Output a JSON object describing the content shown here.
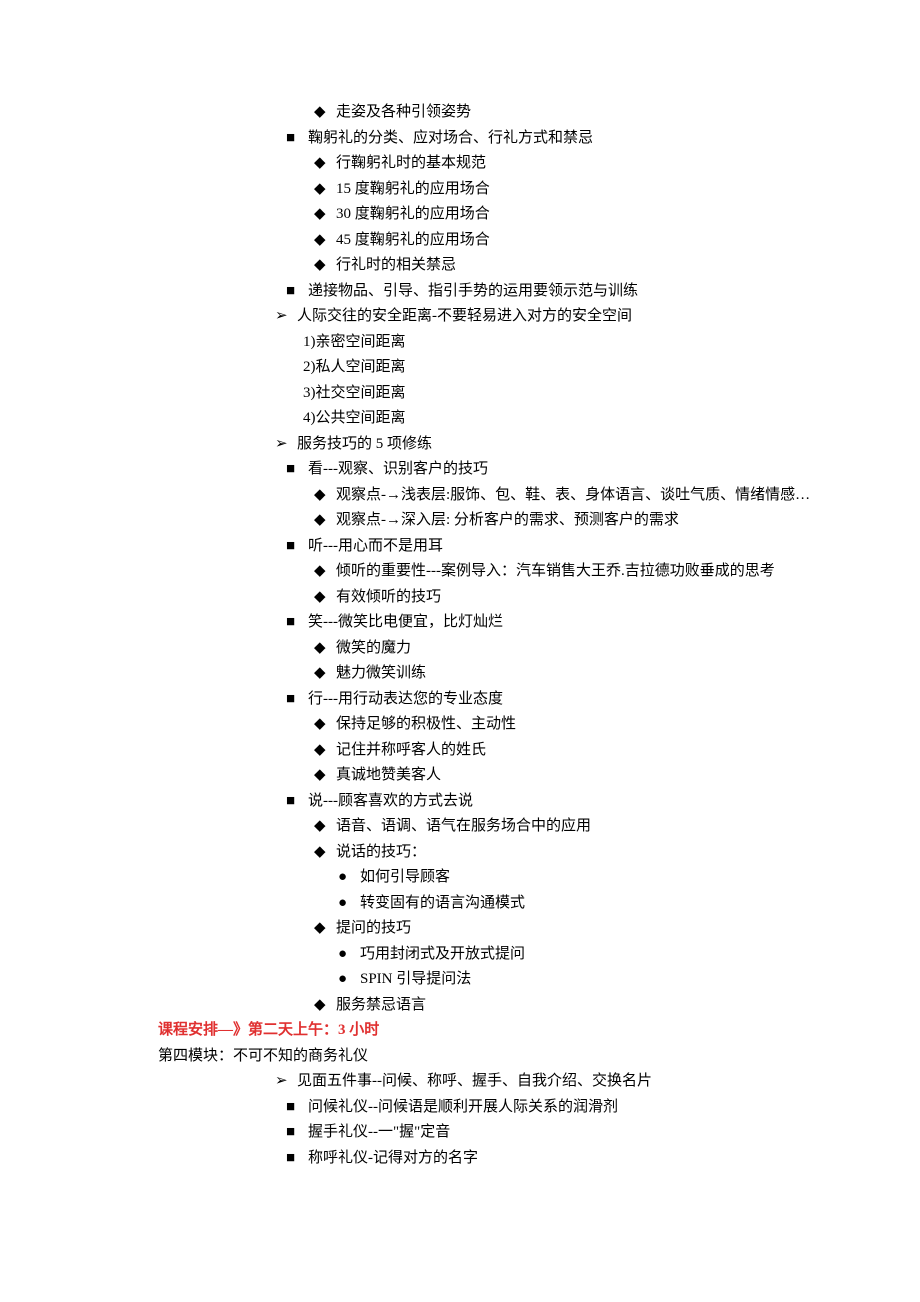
{
  "lines": [
    {
      "indent": "indent-3",
      "bullet": "◆",
      "text": "走姿及各种引领姿势"
    },
    {
      "indent": "indent-2",
      "bullet": "■",
      "text": "鞠躬礼的分类、应对场合、行礼方式和禁忌"
    },
    {
      "indent": "indent-3",
      "bullet": "◆",
      "text": "行鞠躬礼时的基本规范"
    },
    {
      "indent": "indent-3",
      "bullet": "◆",
      "text": "15 度鞠躬礼的应用场合"
    },
    {
      "indent": "indent-3",
      "bullet": "◆",
      "text": "30 度鞠躬礼的应用场合"
    },
    {
      "indent": "indent-3",
      "bullet": "◆",
      "text": "45 度鞠躬礼的应用场合"
    },
    {
      "indent": "indent-3",
      "bullet": "◆",
      "text": "行礼时的相关禁忌"
    },
    {
      "indent": "indent-2",
      "bullet": "■",
      "text": "递接物品、引导、指引手势的运用要领示范与训练"
    },
    {
      "indent": "indent-1",
      "bullet": "➢",
      "text": "人际交往的安全距离-不要轻易进入对方的安全空间"
    },
    {
      "indent": "indent-1b",
      "bullet": "",
      "text": "1)亲密空间距离"
    },
    {
      "indent": "indent-1b",
      "bullet": "",
      "text": "2)私人空间距离"
    },
    {
      "indent": "indent-1b",
      "bullet": "",
      "text": "3)社交空间距离"
    },
    {
      "indent": "indent-1b",
      "bullet": "",
      "text": "4)公共空间距离"
    },
    {
      "indent": "indent-1",
      "bullet": "➢",
      "text": "服务技巧的 5 项修练"
    },
    {
      "indent": "indent-2",
      "bullet": "■",
      "text": "看---观察、识别客户的技巧"
    },
    {
      "indent": "indent-3",
      "bullet": "◆",
      "text": "观察点-→浅表层:服饰、包、鞋、表、身体语言、谈吐气质、情绪情感…"
    },
    {
      "indent": "indent-3",
      "bullet": "◆",
      "text": "观察点-→深入层: 分析客户的需求、预测客户的需求"
    },
    {
      "indent": "indent-2",
      "bullet": "■",
      "text": "听---用心而不是用耳"
    },
    {
      "indent": "indent-3",
      "bullet": "◆",
      "text": "倾听的重要性---案例导入：汽车销售大王乔.吉拉德功败垂成的思考"
    },
    {
      "indent": "indent-3",
      "bullet": "◆",
      "text": "有效倾听的技巧"
    },
    {
      "indent": "indent-2",
      "bullet": "■",
      "text": "笑---微笑比电便宜，比灯灿烂"
    },
    {
      "indent": "indent-3",
      "bullet": "◆",
      "text": "微笑的魔力"
    },
    {
      "indent": "indent-3",
      "bullet": "◆",
      "text": "魅力微笑训练"
    },
    {
      "indent": "indent-2",
      "bullet": "■",
      "text": "行---用行动表达您的专业态度"
    },
    {
      "indent": "indent-3",
      "bullet": "◆",
      "text": "保持足够的积极性、主动性"
    },
    {
      "indent": "indent-3",
      "bullet": "◆",
      "text": "记住并称呼客人的姓氏"
    },
    {
      "indent": "indent-3",
      "bullet": "◆",
      "text": "真诚地赞美客人"
    },
    {
      "indent": "indent-2",
      "bullet": "■",
      "text": "说---顾客喜欢的方式去说"
    },
    {
      "indent": "indent-3",
      "bullet": "◆",
      "text": "语音、语调、语气在服务场合中的应用"
    },
    {
      "indent": "indent-3",
      "bullet": "◆",
      "text": "说话的技巧："
    },
    {
      "indent": "indent-4",
      "bullet": "●",
      "text": "如何引导顾客"
    },
    {
      "indent": "indent-4",
      "bullet": "●",
      "text": "转变固有的语言沟通模式"
    },
    {
      "indent": "indent-3",
      "bullet": "◆",
      "text": "提问的技巧"
    },
    {
      "indent": "indent-4",
      "bullet": "●",
      "text": "巧用封闭式及开放式提问"
    },
    {
      "indent": "indent-4",
      "bullet": "●",
      "text": "SPIN  引导提问法"
    },
    {
      "indent": "indent-3",
      "bullet": "◆",
      "text": "服务禁忌语言"
    }
  ],
  "heading": {
    "part1": "课程安排—》第二天上午：",
    "part2": "3",
    "part3": " 小时"
  },
  "module4_title": "第四模块：不可不知的商务礼仪",
  "module4_lines": [
    {
      "indent": "indent-1",
      "bullet": "➢",
      "text": "见面五件事--问候、称呼、握手、自我介绍、交换名片"
    },
    {
      "indent": "indent-2",
      "bullet": "■",
      "text": "问候礼仪--问候语是顺利开展人际关系的润滑剂"
    },
    {
      "indent": "indent-2",
      "bullet": "■",
      "text": "握手礼仪--一\"握\"定音"
    },
    {
      "indent": "indent-2",
      "bullet": "■",
      "text": "称呼礼仪-记得对方的名字"
    }
  ]
}
